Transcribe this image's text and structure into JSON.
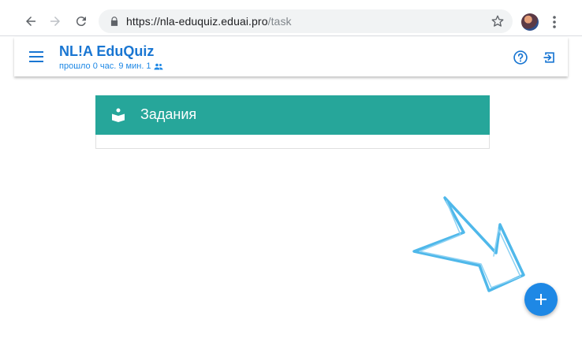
{
  "browser": {
    "url_host": "https://nla-eduquiz.eduai.pro",
    "url_path": "/task"
  },
  "app": {
    "title": "NL!A EduQuiz",
    "elapsed_text": "прошло 0 час. 9 мин.",
    "participants_count": "1"
  },
  "card": {
    "title": "Задания"
  },
  "colors": {
    "brand": "#1976d2",
    "card_header": "#26a69a",
    "fab": "#1e88e5",
    "hint_arrow": "#4fb8ea"
  },
  "icons": {
    "menu": "hamburger-icon",
    "help": "help-circle-icon",
    "exit": "exit-icon",
    "card": "reading-icon",
    "fab": "plus-icon"
  }
}
